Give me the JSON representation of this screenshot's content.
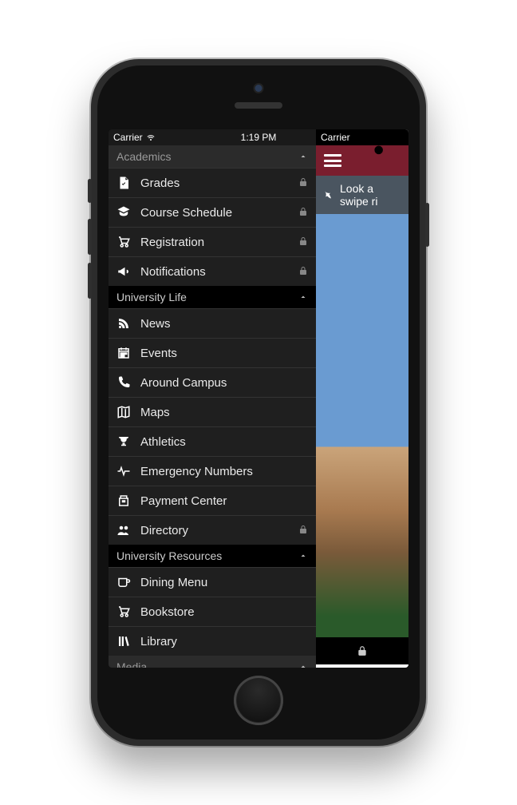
{
  "statusbar": {
    "carrier": "Carrier",
    "time": "1:19 PM"
  },
  "drawer": {
    "sections": [
      {
        "title": "Academics",
        "style": "gray",
        "items": [
          {
            "icon": "grades",
            "label": "Grades",
            "locked": true
          },
          {
            "icon": "schedule",
            "label": "Course Schedule",
            "locked": true
          },
          {
            "icon": "cart",
            "label": "Registration",
            "locked": true
          },
          {
            "icon": "megaphone",
            "label": "Notifications",
            "locked": true
          }
        ]
      },
      {
        "title": "University Life",
        "style": "black",
        "items": [
          {
            "icon": "rss",
            "label": "News",
            "locked": false
          },
          {
            "icon": "calendar",
            "label": "Events",
            "locked": false
          },
          {
            "icon": "phone",
            "label": "Around Campus",
            "locked": false
          },
          {
            "icon": "map",
            "label": "Maps",
            "locked": false
          },
          {
            "icon": "trophy",
            "label": "Athletics",
            "locked": false
          },
          {
            "icon": "pulse",
            "label": "Emergency Numbers",
            "locked": false
          },
          {
            "icon": "register",
            "label": "Payment Center",
            "locked": false
          },
          {
            "icon": "people",
            "label": "Directory",
            "locked": true
          }
        ]
      },
      {
        "title": "University Resources",
        "style": "black",
        "items": [
          {
            "icon": "cup",
            "label": "Dining Menu",
            "locked": false
          },
          {
            "icon": "cart",
            "label": "Bookstore",
            "locked": false
          },
          {
            "icon": "library",
            "label": "Library",
            "locked": false
          }
        ]
      },
      {
        "title": "Media",
        "style": "gray",
        "items": []
      }
    ]
  },
  "main": {
    "carrier": "Carrier",
    "hint_line1": "Look a",
    "hint_line2": "swipe ri"
  }
}
